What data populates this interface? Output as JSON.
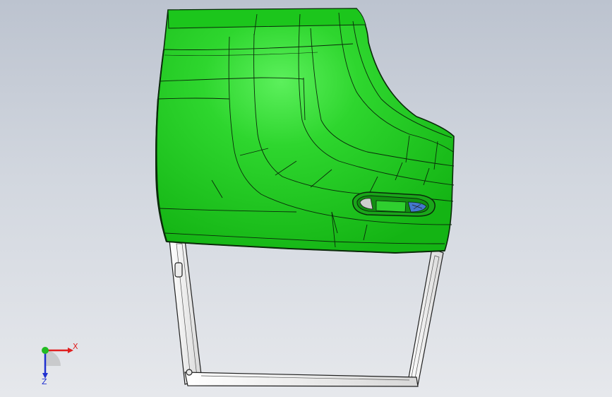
{
  "viewport": {
    "background_top": "#bcc3cf",
    "background_bottom": "#e6e8ec"
  },
  "model": {
    "face_color": "#22cc22",
    "highlight_color": "#55ee55",
    "edge_color": "#0a2a0a",
    "frame_color": "#f4f4f4"
  },
  "triad": {
    "x_label": "X",
    "z_label": "Z",
    "x_color": "#e02020",
    "y_color": "#22bb22",
    "z_color": "#2030d0"
  }
}
